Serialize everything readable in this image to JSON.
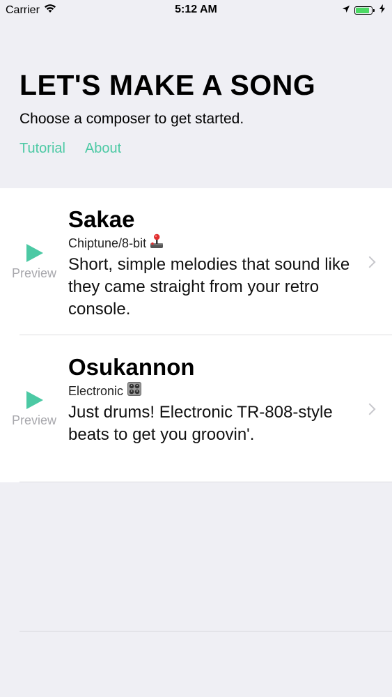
{
  "status_bar": {
    "carrier": "Carrier",
    "time": "5:12 AM",
    "battery_level": 0.85,
    "battery_color": "#4cd964"
  },
  "header": {
    "title": "LET'S MAKE A SONG",
    "subtitle": "Choose a composer to get started.",
    "links": [
      {
        "label": "Tutorial"
      },
      {
        "label": "About"
      }
    ]
  },
  "accent_color": "#4cc9a4",
  "composers": [
    {
      "name": "Sakae",
      "genre": "Chiptune/8-bit",
      "genre_icon": "joystick-icon",
      "description": "Short, simple melodies that sound like they came straight from your retro console.",
      "preview_label": "Preview"
    },
    {
      "name": "Osukannon",
      "genre": "Electronic",
      "genre_icon": "control-knobs-icon",
      "description": "Just drums! Electronic TR-808-style beats to get you groovin'.",
      "preview_label": "Preview"
    }
  ]
}
